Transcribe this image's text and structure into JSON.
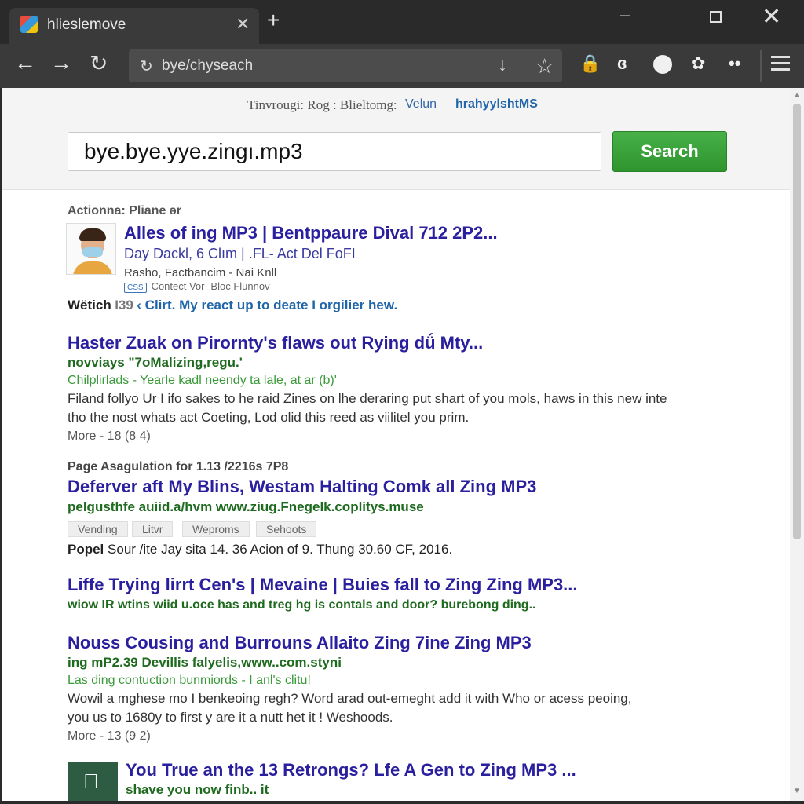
{
  "browser": {
    "tab_title": "hlieslemove",
    "tab_close": "✕",
    "new_tab": "+",
    "address": "bye/chyseach",
    "window": {
      "minimize": "‒",
      "close": "✕"
    },
    "nav": {
      "back": "←",
      "forward": "→",
      "reload": "↻"
    },
    "omnibox_icons": {
      "lock": "↻",
      "download": "↓",
      "star": "☆"
    },
    "extensions": {
      "ext1": "🔒",
      "ext2": "ɞ",
      "ext4": "✿",
      "ext5": "••"
    }
  },
  "page": {
    "top_nav": [
      "Tinvrougi: Rog : Blieltomg:",
      "Velun",
      "hrahyylshtMS"
    ],
    "search_query": "bye.bye.yye.zingı.mp3",
    "search_button": "Search",
    "results": [
      {
        "header": "Actionna: Pliane ər",
        "title": "Alles of ing MP3 | Bentppaure Dival 712 2P2...",
        "line1": "Day Dackl, 6 Clım | .FL- Act Del FoFI",
        "line2": "Rasho, Factbancim - Nai Knll",
        "badge": "CSS",
        "line3": "Contect Vor- Bloc Flunnov",
        "watch_label": "Wëtich",
        "watch_count": "I39",
        "watch_link": "Clirt. My react up to deate I orgilier hew."
      },
      {
        "title": "Haster Zuak on Pirornty's flaws out Rying dǘ Mty...",
        "url": "novviays \"7oMalizing,regu.'",
        "sub": "Chilplirlads - Yearle kadl neendy ta Ɩale, at ar (b)'",
        "desc1": "Filand follyo Ur I ifo sakes to he raid Zines on lhe deraring put shart of you mols, haws in this new inte",
        "desc2": "tho the nost whats act Coeting, Lod olid this reed as viilitel you prim.",
        "more": "More - 18 (8 4)"
      },
      {
        "header": "Page Asagulation for 1.13 /2216s 7P8",
        "title": "Deferver aft My Blins, Westam Halting Comk all Zing MP3",
        "url": "pelgusthfe auiid.a/hvm www.ziug.Fnegelk.coplitys.muse",
        "chips": [
          "Vending",
          "Litvr",
          "Weproms",
          "Sehoots"
        ],
        "meta_bold": "Popel",
        "meta": "Sour /ite Jay sita 14. 36 Acion of 9. Thung 30.60 CF, 2016."
      },
      {
        "title": "Liffe Trying lirrt Cen's | Mevaine | Buies fall to Zing Zing MP3...",
        "url": "wiow IR wtins wiid u.oce has and treg hg is contals and door? burebong ding.."
      },
      {
        "title": "Nouss Cousing and Burrouns Allaito Zing 7ine Zing MP3",
        "url": "ing mP2.39 Devillis falyelis,www..com.styni",
        "sub": "Las ding contuction bunmiords - I anl's clitu!",
        "desc1": "Wowil a mghese mo I benkeoing regh? Word arad out-emeght add it with Who or acess peoing,",
        "desc2": "you us to 1680y to first y are it a nutt het it ! Weshoods.",
        "more": "More - 13 (9 2)"
      },
      {
        "title": "You True an the 13 Retrongs? Lfe A Gen to Zing MP3 ...",
        "url": "shave you now finb.. it",
        "icon": "apple-icon"
      }
    ]
  }
}
